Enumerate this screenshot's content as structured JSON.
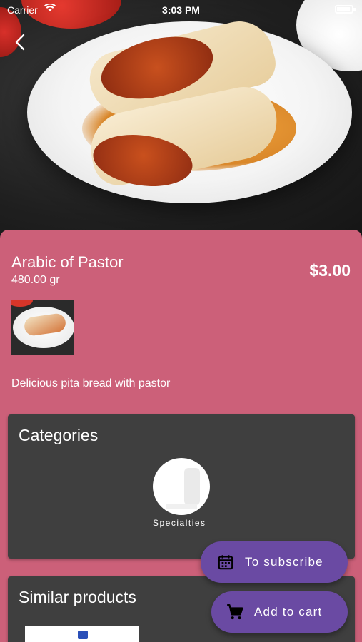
{
  "status_bar": {
    "carrier": "Carrier",
    "time": "3:03 PM"
  },
  "product": {
    "name": "Arabic of Pastor",
    "weight": "480.00 gr",
    "price": "$3.00",
    "description": "Delicious pita bread with pastor"
  },
  "categories": {
    "title": "Categories",
    "items": [
      {
        "label": "Specialties"
      }
    ]
  },
  "similar_products": {
    "title": "Similar products"
  },
  "actions": {
    "subscribe_label": "To subscribe",
    "add_to_cart_label": "Add to cart"
  },
  "colors": {
    "sheet": "#cc6079",
    "card": "#3f3f3f",
    "fab": "#6a4aa3",
    "text": "#ffffff"
  },
  "icons": {
    "back": "chevron-left-icon",
    "subscribe": "calendar-icon",
    "cart": "shopping-cart-icon",
    "wifi": "wifi-icon",
    "battery": "battery-icon"
  }
}
